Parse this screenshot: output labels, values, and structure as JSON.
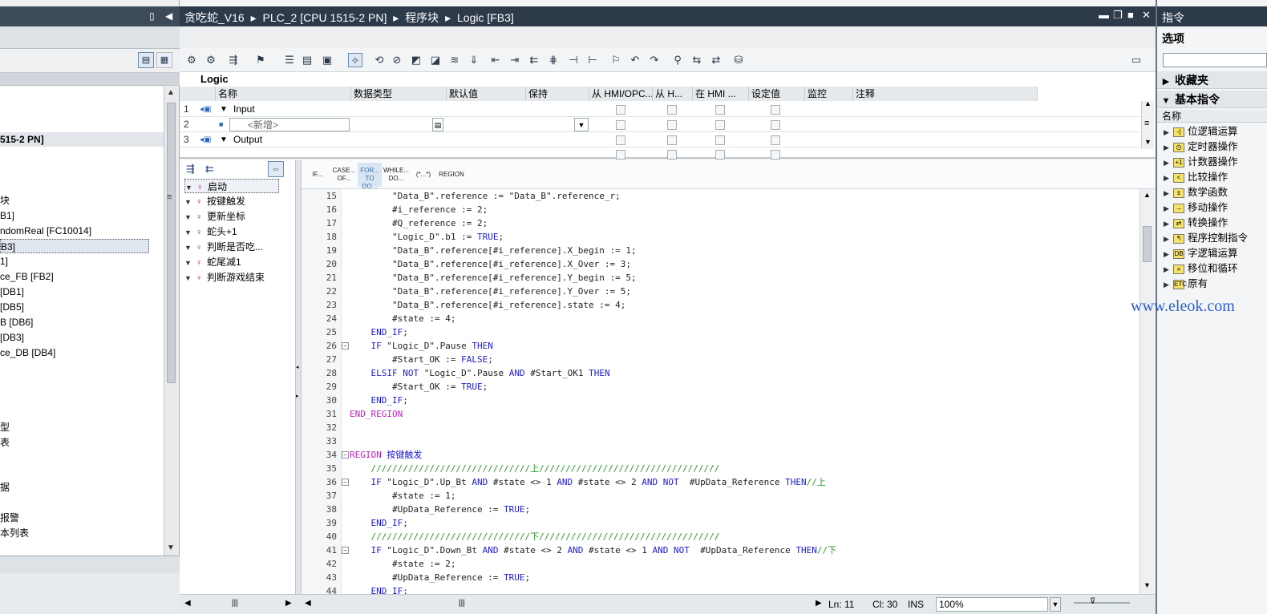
{
  "left_panel": {
    "tree_items": [
      {
        "text": "515-2 PN]",
        "top": 0
      },
      {
        "text": "块"
      },
      {
        "text": "B1]"
      },
      {
        "text": "ndomReal [FC10014]"
      },
      {
        "text": "B3]"
      },
      {
        "text": "1]"
      },
      {
        "text": "ce_FB [FB2]"
      },
      {
        "text": "[DB1]"
      },
      {
        "text": "[DB5]"
      },
      {
        "text": "B [DB6]"
      },
      {
        "text": "[DB3]"
      },
      {
        "text": "ce_DB [DB4]"
      },
      {
        "text": "型"
      },
      {
        "text": "表"
      },
      {
        "text": "据"
      },
      {
        "text": "报警"
      },
      {
        "text": "本列表"
      }
    ]
  },
  "title": {
    "crumbs": [
      "贪吃蛇_V16",
      "PLC_2 [CPU 1515-2 PN]",
      "程序块",
      "Logic [FB3]"
    ]
  },
  "interface": {
    "block_name": "Logic",
    "columns": [
      "名称",
      "数据类型",
      "默认值",
      "保持",
      "从 HMI/OPC...",
      "从 H...",
      "在 HMI ...",
      "设定值",
      "监控",
      "注释"
    ],
    "rows": [
      {
        "num": "1",
        "name": "Input"
      },
      {
        "num": "2",
        "name": "<新增>"
      },
      {
        "num": "3",
        "name": "Output"
      }
    ]
  },
  "regions": [
    "启动",
    "按键触发",
    "更新坐标",
    "蛇头+1",
    "判断是否吃...",
    "蛇尾减1",
    "判断游戏结束"
  ],
  "palette": [
    {
      "line1": "IF...",
      "line2": ""
    },
    {
      "line1": "CASE...",
      "line2": "OF..."
    },
    {
      "line1": "FOR...",
      "line2": "TO DO..."
    },
    {
      "line1": "WHILE...",
      "line2": "DO..."
    },
    {
      "line1": "(*...*)",
      "line2": ""
    },
    {
      "line1": "REGION",
      "line2": ""
    }
  ],
  "code_lines": [
    {
      "n": "15",
      "t": "        \"Data_B\".reference := \"Data_B\".reference_r;"
    },
    {
      "n": "16",
      "t": "        #i_reference := 2;"
    },
    {
      "n": "17",
      "t": "        #Q_reference := 2;"
    },
    {
      "n": "18",
      "t": "        \"Logic_D\".b1 := TRUE;"
    },
    {
      "n": "19",
      "t": "        \"Data_B\".reference[#i_reference].X_begin := 1;"
    },
    {
      "n": "20",
      "t": "        \"Data_B\".reference[#i_reference].X_Over := 3;"
    },
    {
      "n": "21",
      "t": "        \"Data_B\".reference[#i_reference].Y_begin := 5;"
    },
    {
      "n": "22",
      "t": "        \"Data_B\".reference[#i_reference].Y_Over := 5;"
    },
    {
      "n": "23",
      "t": "        \"Data_B\".reference[#i_reference].state := 4;"
    },
    {
      "n": "24",
      "t": "        #state := 4;"
    },
    {
      "n": "25",
      "t": "    END_IF;"
    },
    {
      "n": "26",
      "t": "    IF \"Logic_D\".Pause THEN"
    },
    {
      "n": "27",
      "t": "        #Start_OK := FALSE;"
    },
    {
      "n": "28",
      "t": "    ELSIF NOT \"Logic_D\".Pause AND #Start_OK1 THEN"
    },
    {
      "n": "29",
      "t": "        #Start_OK := TRUE;"
    },
    {
      "n": "30",
      "t": "    END_IF;"
    },
    {
      "n": "31",
      "t": "END_REGION"
    },
    {
      "n": "32",
      "t": ""
    },
    {
      "n": "33",
      "t": ""
    },
    {
      "n": "34",
      "t": "REGION 按键触发"
    },
    {
      "n": "35",
      "t": "    //////////////////////////////上//////////////////////////////////"
    },
    {
      "n": "36",
      "t": "    IF \"Logic_D\".Up_Bt AND #state <> 1 AND #state <> 2 AND NOT  #UpData_Reference THEN//上"
    },
    {
      "n": "37",
      "t": "        #state := 1;"
    },
    {
      "n": "38",
      "t": "        #UpData_Reference := TRUE;"
    },
    {
      "n": "39",
      "t": "    END_IF;"
    },
    {
      "n": "40",
      "t": "    //////////////////////////////下//////////////////////////////////"
    },
    {
      "n": "41",
      "t": "    IF \"Logic_D\".Down_Bt AND #state <> 2 AND #state <> 1 AND NOT  #UpData_Reference THEN//下"
    },
    {
      "n": "42",
      "t": "        #state := 2;"
    },
    {
      "n": "43",
      "t": "        #UpData_Reference := TRUE;"
    },
    {
      "n": "44",
      "t": "    END_IF;"
    }
  ],
  "status": {
    "ln": "Ln: 11",
    "cl": "Cl: 30",
    "ins": "INS",
    "zoom": "100%"
  },
  "right_panel": {
    "title": "指令",
    "options": "选项",
    "favorites": "收藏夹",
    "basic": "基本指令",
    "list_header": "名称",
    "items": [
      "位逻辑运算",
      "定时器操作",
      "计数器操作",
      "比较操作",
      "数学函数",
      "移动操作",
      "转换操作",
      "程序控制指令",
      "字逻辑运算",
      "移位和循环",
      "原有"
    ],
    "icon_labels": [
      "-|",
      "◷",
      "+1",
      "<",
      "±",
      "→",
      "⇄",
      "↰",
      "DB",
      "»",
      "ETC"
    ]
  },
  "watermark": "www.eleok.com"
}
